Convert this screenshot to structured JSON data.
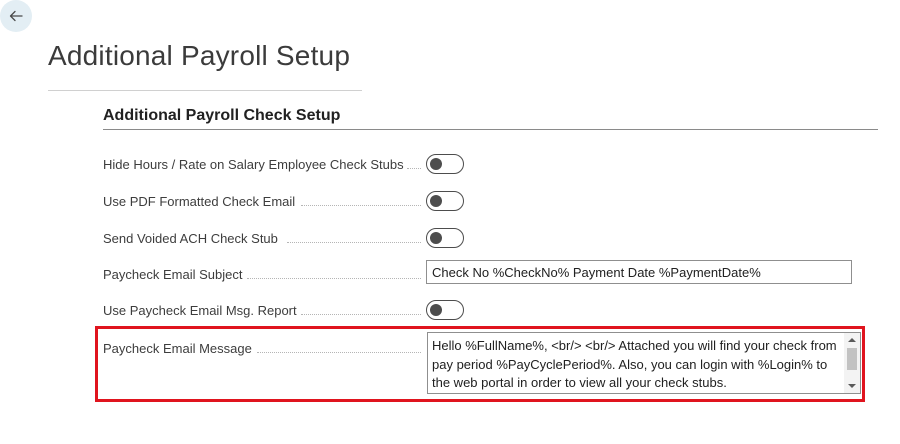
{
  "page": {
    "title": "Additional Payroll Setup",
    "back_icon": "back-arrow-icon"
  },
  "section": {
    "title": "Additional Payroll Check Setup"
  },
  "fields": [
    {
      "label": "Hide Hours / Rate on Salary Employee Check Stubs",
      "type": "toggle",
      "value": "off"
    },
    {
      "label": "Use PDF Formatted Check Email",
      "type": "toggle",
      "value": "off"
    },
    {
      "label": "Send Voided ACH Check Stub",
      "type": "toggle",
      "value": "off"
    },
    {
      "label": "Paycheck Email Subject",
      "type": "text",
      "value": "Check No %CheckNo% Payment Date %PaymentDate%"
    },
    {
      "label": "Use Paycheck Email Msg. Report",
      "type": "toggle",
      "value": "off"
    },
    {
      "label": "Paycheck Email Message",
      "type": "textarea",
      "value": "Hello %FullName%, <br/> <br/> Attached you will find your check from pay period %PayCyclePeriod%.  Also, you can login with %Login% to the web portal in order to view all your check stubs."
    }
  ],
  "colors": {
    "highlight": "#e0141e",
    "back_button_bg": "#e3eef4",
    "toggle": "#4d4d4d"
  }
}
